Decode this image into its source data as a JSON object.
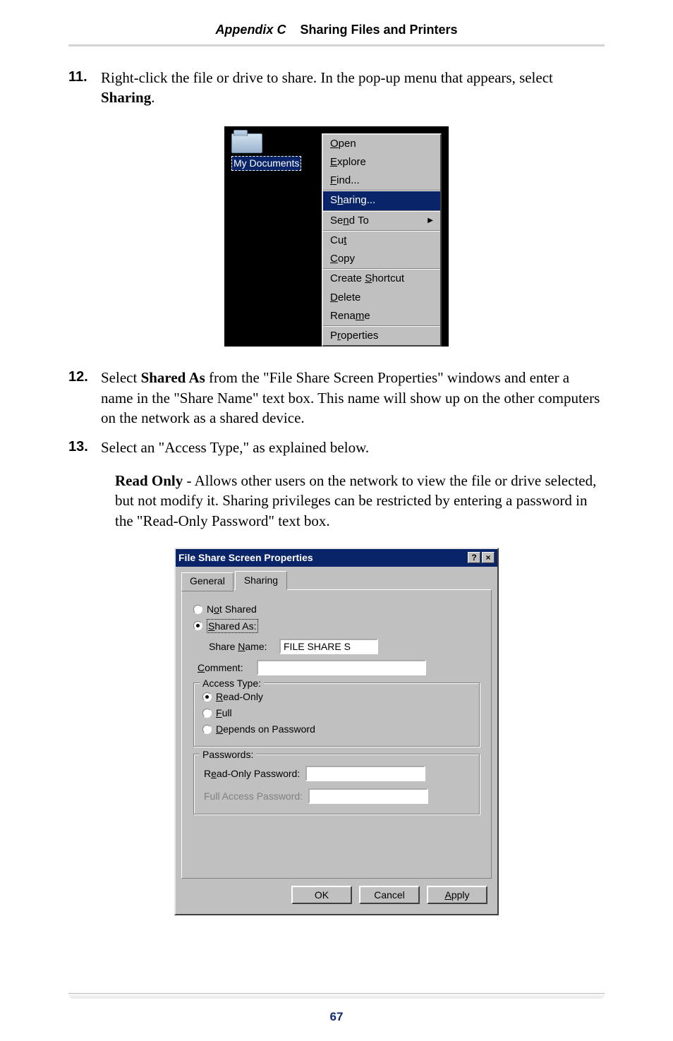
{
  "header": {
    "appendix": "Appendix C",
    "title": "Sharing Files and Printers"
  },
  "steps": {
    "s11": {
      "num": "11.",
      "text_before": "Right-click the file or drive to share. In the pop-up menu that appears, select ",
      "bold": "Sharing",
      "text_after": "."
    },
    "s12": {
      "num": "12.",
      "text_a": "Select ",
      "bold": "Shared As",
      "text_b": " from the \"File Share Screen Properties\" windows and enter a name in the \"Share Name\" text box. This name will show up on the other computers on the network as a shared device."
    },
    "s13": {
      "num": "13.",
      "text": "Select an \"Access Type,\" as explained below."
    },
    "readonly": {
      "bold": "Read Only",
      "text": " - Allows other users on the network to view the file or drive selected, but not modify it. Sharing privileges can be restricted by entering a password in the \"Read-Only Password\" text box."
    }
  },
  "context_menu": {
    "icon_label": "My Documents",
    "items": {
      "open": "Open",
      "explore": "Explore",
      "find": "Find...",
      "sharing": "Sharing...",
      "sendto": "Send To",
      "cut": "Cut",
      "copy": "Copy",
      "create_shortcut": "Create Shortcut",
      "delete": "Delete",
      "rename": "Rename",
      "properties": "Properties"
    }
  },
  "dialog": {
    "title": "File Share Screen Properties",
    "tabs": {
      "general": "General",
      "sharing": "Sharing"
    },
    "not_shared": "Not Shared",
    "shared_as": "Shared As:",
    "share_name_label": "Share Name:",
    "share_name_value": "FILE SHARE S",
    "comment_label": "Comment:",
    "access_type_legend": "Access Type:",
    "read_only": "Read-Only",
    "full": "Full",
    "depends": "Depends on Password",
    "passwords_legend": "Passwords:",
    "ro_pw_label": "Read-Only Password:",
    "full_pw_label": "Full Access Password:",
    "ok": "OK",
    "cancel": "Cancel",
    "apply": "Apply"
  },
  "page_number": "67"
}
